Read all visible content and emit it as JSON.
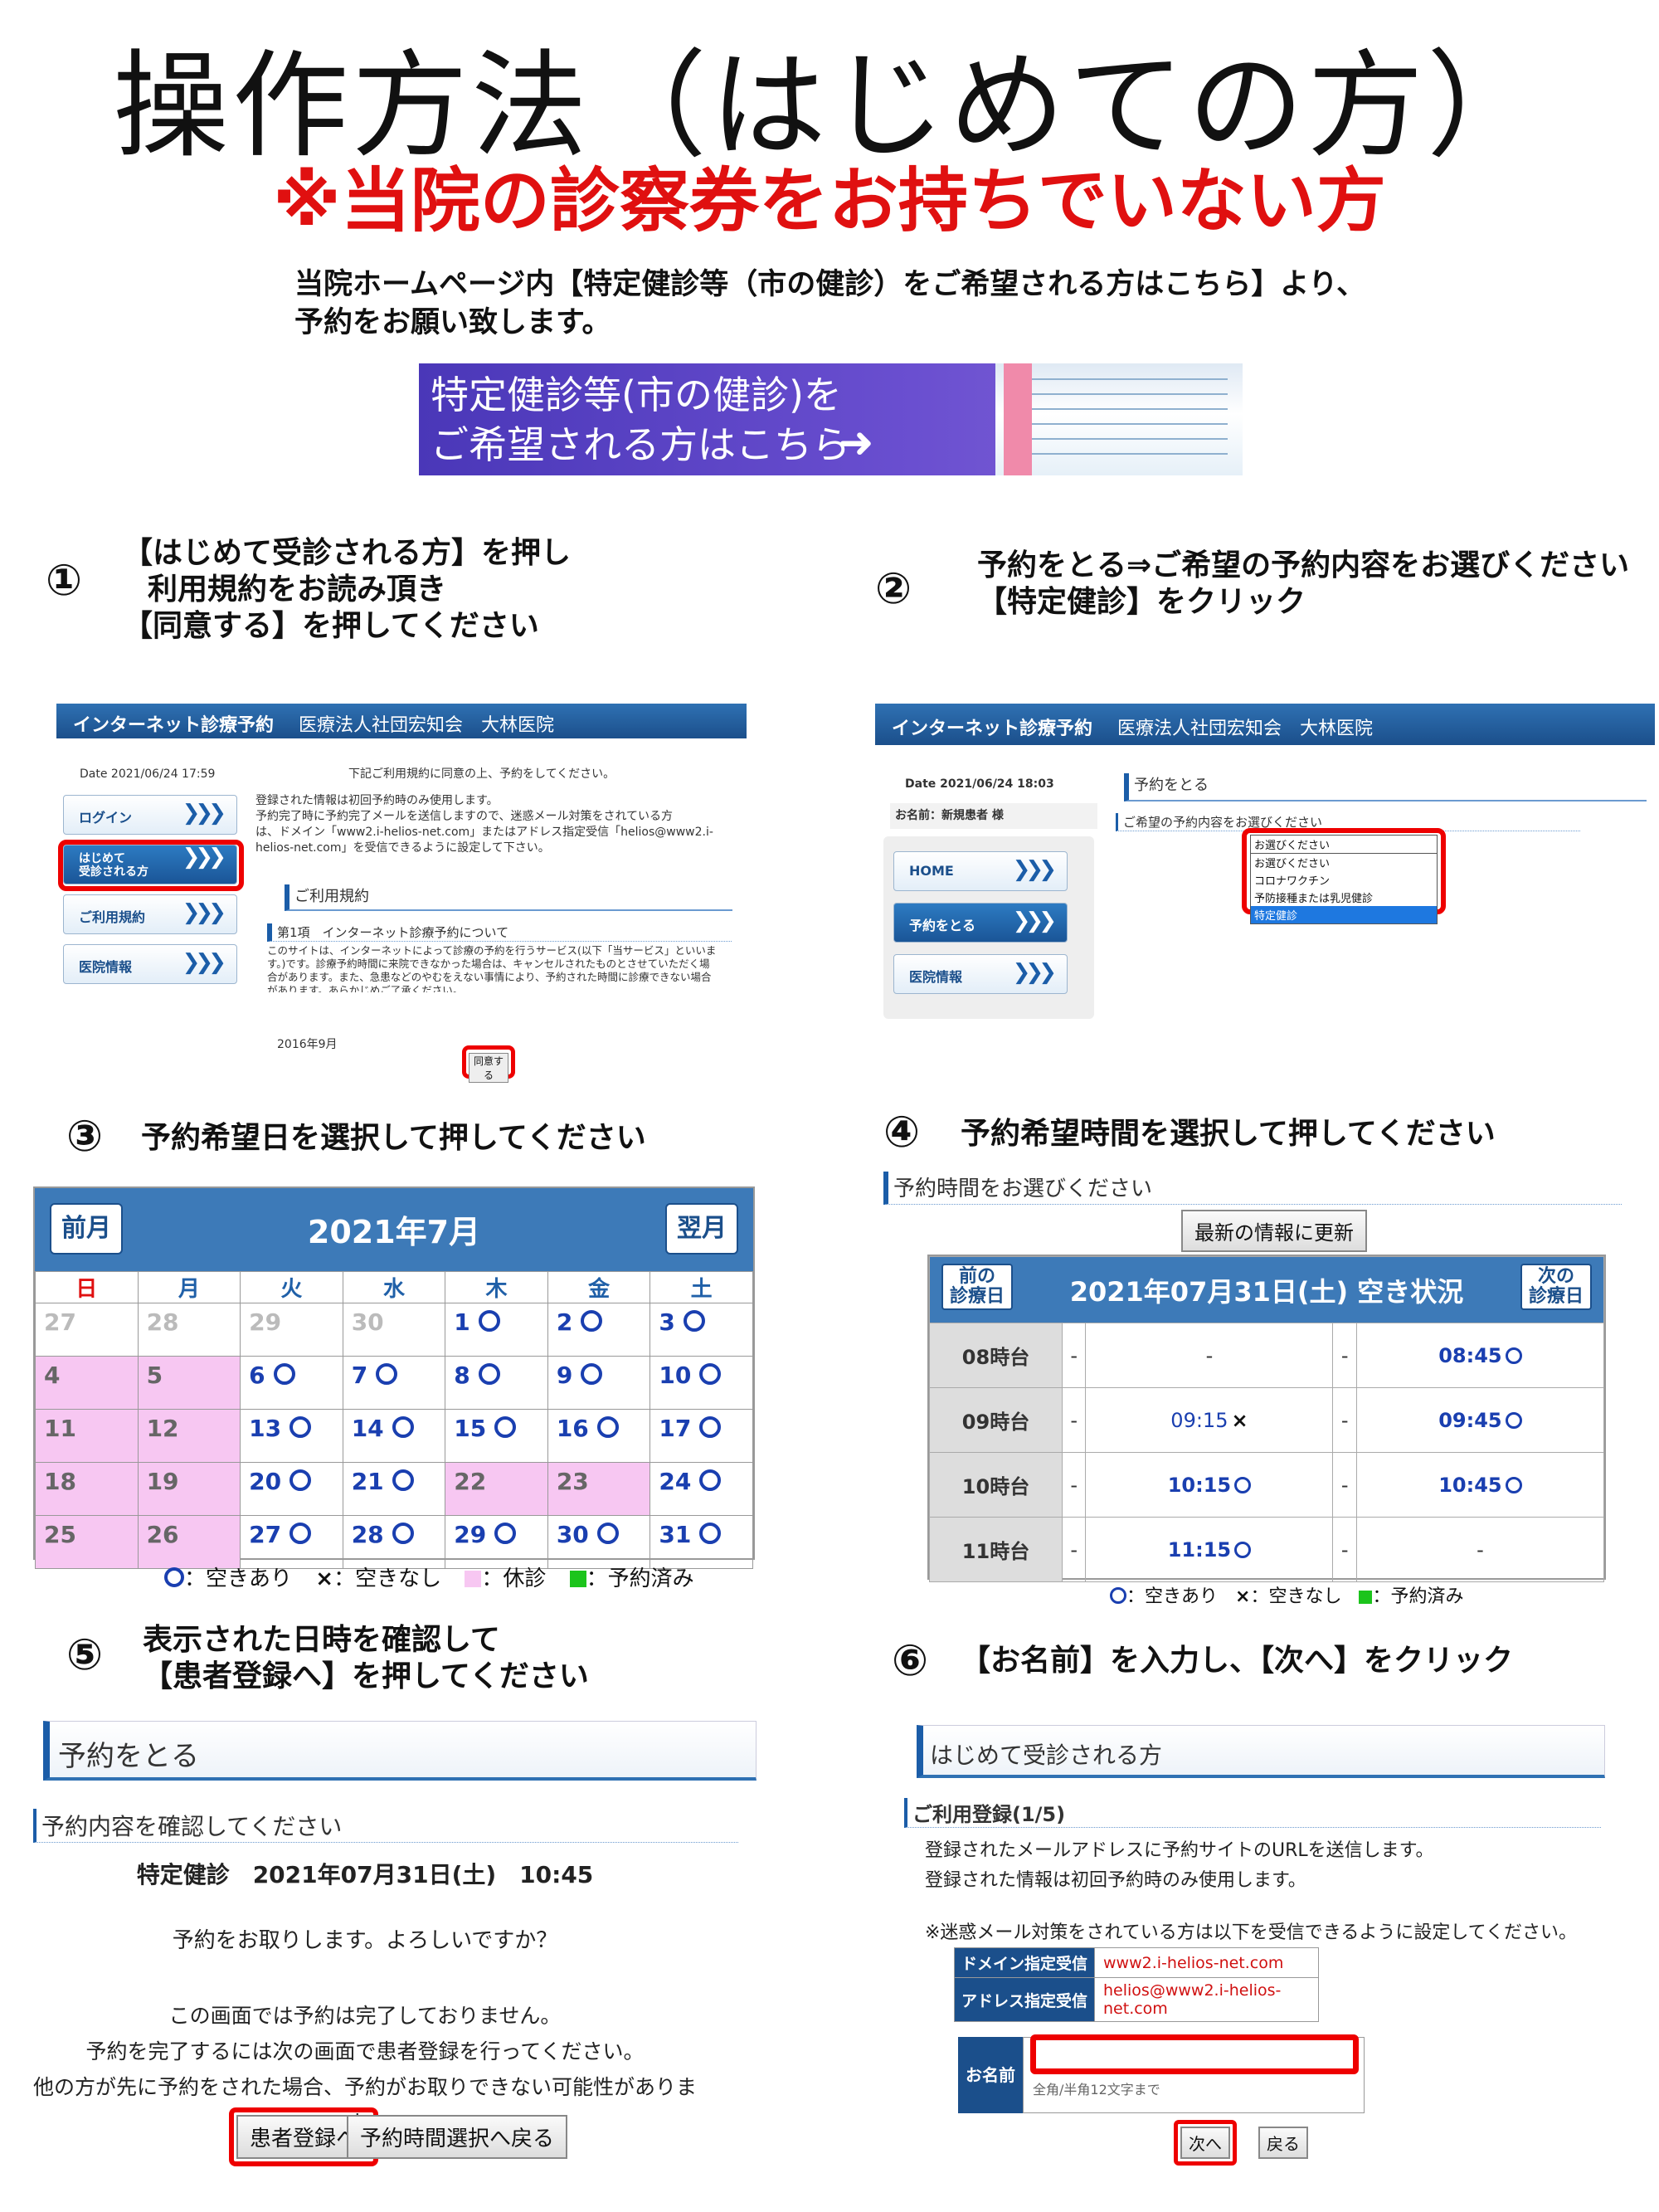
{
  "title": "操作方法（はじめての方）",
  "subtitle": "※当院の診察券をお持ちでいない方",
  "intro": {
    "line1": "当院ホームページ内【特定健診等（市の健診）をご希望される方はこちら】より、",
    "line2": "予約をお願い致します。"
  },
  "banner": {
    "line1": "特定健診等(市の健診)を",
    "line2": "ご希望される方はこちら",
    "arrow": "➜"
  },
  "steps": {
    "s1": {
      "num": "①",
      "l1": "【はじめて受診される方】を押し",
      "l2": "利用規約をお読み頂き",
      "l3": "【同意する】を押してください"
    },
    "s2": {
      "num": "②",
      "l1": "予約をとる⇒ご希望の予約内容をお選びください",
      "l2": "【特定健診】をクリック"
    },
    "s3": {
      "num": "③",
      "l1": "予約希望日を選択して押してください"
    },
    "s4": {
      "num": "④",
      "l1": "予約希望時間を選択して押してください"
    },
    "s5": {
      "num": "⑤",
      "l1": "表示された日時を確認して",
      "l2": "【患者登録へ】を押してください"
    },
    "s6": {
      "num": "⑥",
      "l1": "【お名前】を入力し、【次へ】をクリック"
    }
  },
  "shot1": {
    "header": "インターネット診療予約",
    "clinic": "医療法人社団宏知会　大林医院",
    "date": "Date 2021/06/24 17:59",
    "notice": "下記ご利用規約に同意の上、予約をしてください。",
    "body1": "登録された情報は初回予約時のみ使用します。",
    "body2": "予約完了時に予約完了メールを送信しますので、迷惑メール対策をされている方",
    "body3": "は、ドメイン「www2.i-helios-net.com」またはアドレス指定受信「helios@www2.i-",
    "body4": "helios-net.com」を受信できるように設定して下さい。",
    "nav": [
      "ログイン",
      "はじめて\n受診される方",
      "ご利用規約",
      "医院情報"
    ],
    "terms_title": "ご利用規約",
    "article": "第1項　インターネット診療予約について",
    "article_text1": "このサイトは、インターネットによって診療の予約を行うサービス(以下「当サービス」といいま",
    "article_text2": "す。)です。診療予約時間に来院できなかった場合は、キャンセルされたものとさせていただく場",
    "article_text3": "合があります。また、急患などのやむをえない事情により、予約された時間に診療できない場合",
    "article_text4": "があります。あらかじめご了承ください。",
    "year": "2016年9月",
    "agree": "同意する"
  },
  "shot2": {
    "header": "インターネット診療予約",
    "clinic": "医療法人社団宏知会　大林医院",
    "date": "Date 2021/06/24 18:03",
    "name": "お名前：新規患者 様",
    "nav": [
      "HOME",
      "予約をとる",
      "医院情報"
    ],
    "section": "予約をとる",
    "choose": "ご希望の予約内容をお選びください",
    "select_value": "お選びください",
    "options": [
      "お選びください",
      "コロナワクチン",
      "予防接種または乳児健診",
      "特定健診"
    ]
  },
  "calendar": {
    "prev": "前月",
    "next": "翌月",
    "month": "2021年7月",
    "weekdays": [
      "日",
      "月",
      "火",
      "水",
      "木",
      "金",
      "土"
    ],
    "rows": [
      [
        "27",
        "28",
        "29",
        "30",
        "1",
        "2",
        "3"
      ],
      [
        "4",
        "5",
        "6",
        "7",
        "8",
        "9",
        "10"
      ],
      [
        "11",
        "12",
        "13",
        "14",
        "15",
        "16",
        "17"
      ],
      [
        "18",
        "19",
        "20",
        "21",
        "22",
        "23",
        "24"
      ],
      [
        "25",
        "26",
        "27",
        "28",
        "29",
        "30",
        "31"
      ]
    ],
    "legend": {
      "open": "：空きあり",
      "full": "：空きなし",
      "closed": "：休診",
      "booked": "：予約済み",
      "cross": "×"
    }
  },
  "timetable": {
    "heading": "予約時間をお選びください",
    "refresh": "最新の情報に更新",
    "prev": "前の\n診療日",
    "next": "次の\n診療日",
    "title": "2021年07月31日(土) 空き状況",
    "rows": [
      {
        "hour": "08時台",
        "c": [
          "-",
          "-",
          "-",
          "08:45"
        ]
      },
      {
        "hour": "09時台",
        "c": [
          "-",
          "09:15",
          "-",
          "09:45"
        ]
      },
      {
        "hour": "10時台",
        "c": [
          "-",
          "10:15",
          "-",
          "10:45"
        ]
      },
      {
        "hour": "11時台",
        "c": [
          "-",
          "11:15",
          "-",
          "-"
        ]
      }
    ]
  },
  "shot5": {
    "section": "予約をとる",
    "confirm": "予約内容を確認してください",
    "detail": "特定健診　2021年07月31日(土)　10:45",
    "question": "予約をお取りします。よろしいですか？",
    "note1": "この画面では予約は完了しておりません。",
    "note2": "予約を完了するには次の画面で患者登録を行ってください。",
    "note3": "他の方が先に予約をされた場合、予約がお取りできない可能性があります。",
    "register": "患者登録へ",
    "back": "予約時間選択へ戻る"
  },
  "shot6": {
    "section": "はじめて受診される方",
    "reg": "ご利用登録(1/5)",
    "t1": "登録されたメールアドレスに予約サイトのURLを送信します。",
    "t2": "登録された情報は初回予約時のみ使用します。",
    "t3": "※迷惑メール対策をされている方は以下を受信できるように設定してください。",
    "domain_label": "ドメイン指定受信",
    "domain": "www2.i-helios-net.com",
    "addr_label": "アドレス指定受信",
    "addr": "helios@www2.i-helios-net.com",
    "name_label": "お名前",
    "name_hint": "全角/半角12文字まで",
    "next": "次へ",
    "back": "戻る"
  },
  "colors": {
    "accent_red": "#e01010",
    "brand_blue": "#1b4f8b",
    "banner_purple": "#5a44c8",
    "holiday_pink": "#f7c7f2"
  }
}
